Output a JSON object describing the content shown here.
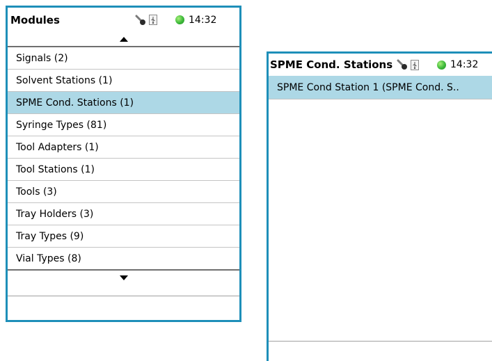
{
  "colors": {
    "frame_border": "#1e8fb9",
    "selected_row": "#add8e6",
    "status_led": "#3cb83a"
  },
  "modules_screen": {
    "title": "Modules",
    "status": {
      "icons": [
        "key-icon",
        "usb-icon",
        "status-led-icon"
      ],
      "time": "14:32"
    },
    "scroll_up_icon": "triangle-up-icon",
    "scroll_down_icon": "triangle-down-icon",
    "items": [
      {
        "label": "Signals (2)",
        "selected": false
      },
      {
        "label": "Solvent Stations (1)",
        "selected": false
      },
      {
        "label": "SPME Cond. Stations (1)",
        "selected": true
      },
      {
        "label": "Syringe Types (81)",
        "selected": false
      },
      {
        "label": "Tool Adapters (1)",
        "selected": false
      },
      {
        "label": "Tool Stations (1)",
        "selected": false
      },
      {
        "label": "Tools (3)",
        "selected": false
      },
      {
        "label": "Tray Holders (3)",
        "selected": false
      },
      {
        "label": "Tray Types (9)",
        "selected": false
      },
      {
        "label": "Vial Types (8)",
        "selected": false
      }
    ]
  },
  "spme_screen": {
    "title": "SPME Cond. Stations",
    "status": {
      "icons": [
        "key-icon",
        "usb-icon",
        "status-led-icon"
      ],
      "time": "14:32"
    },
    "items": [
      {
        "label": "SPME Cond Station 1 (SPME Cond. S..",
        "selected": true
      }
    ]
  }
}
